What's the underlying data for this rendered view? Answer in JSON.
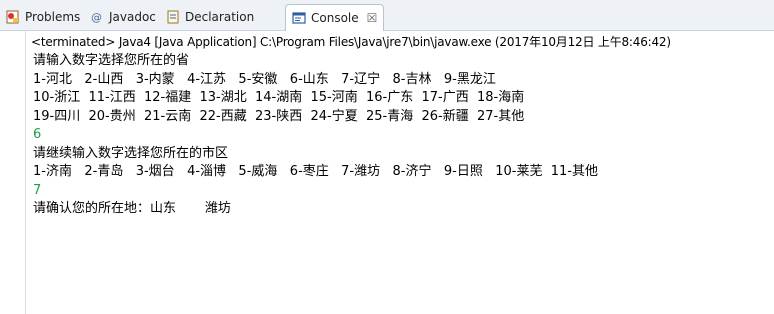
{
  "tabs": [
    {
      "label": "Problems",
      "icon": "problems-icon",
      "active": false
    },
    {
      "label": "Javadoc",
      "icon": "javadoc-icon",
      "active": false
    },
    {
      "label": "Declaration",
      "icon": "declaration-icon",
      "active": false
    },
    {
      "label": "Console",
      "icon": "console-icon",
      "active": true
    }
  ],
  "close_glyph": "☒",
  "status": "<terminated> Java4 [Java Application] C:\\Program Files\\Java\\jre7\\bin\\javaw.exe (2017年10月12日 上午8:46:42)",
  "console": {
    "lines": [
      {
        "text": "请输入数字选择您所在的省",
        "type": "output"
      },
      {
        "text": "1-河北   2-山西   3-内蒙   4-江苏   5-安徽   6-山东   7-辽宁   8-吉林   9-黑龙江",
        "type": "output"
      },
      {
        "text": "10-浙江  11-江西  12-福建  13-湖北  14-湖南  15-河南  16-广东  17-广西  18-海南",
        "type": "output"
      },
      {
        "text": "19-四川  20-贵州  21-云南  22-西藏  23-陕西  24-宁夏  25-青海  26-新疆  27-其他",
        "type": "output"
      },
      {
        "text": "6",
        "type": "input"
      },
      {
        "text": "请继续输入数字选择您所在的市区",
        "type": "output"
      },
      {
        "text": "1-济南   2-青岛   3-烟台   4-淄博   5-威海   6-枣庄   7-潍坊   8-济宁   9-日照   10-莱芜  11-其他",
        "type": "output"
      },
      {
        "text": "7",
        "type": "input"
      },
      {
        "text": "请确认您的所在地：山东       潍坊",
        "type": "output"
      }
    ],
    "input_color": "#1e9e4a"
  }
}
